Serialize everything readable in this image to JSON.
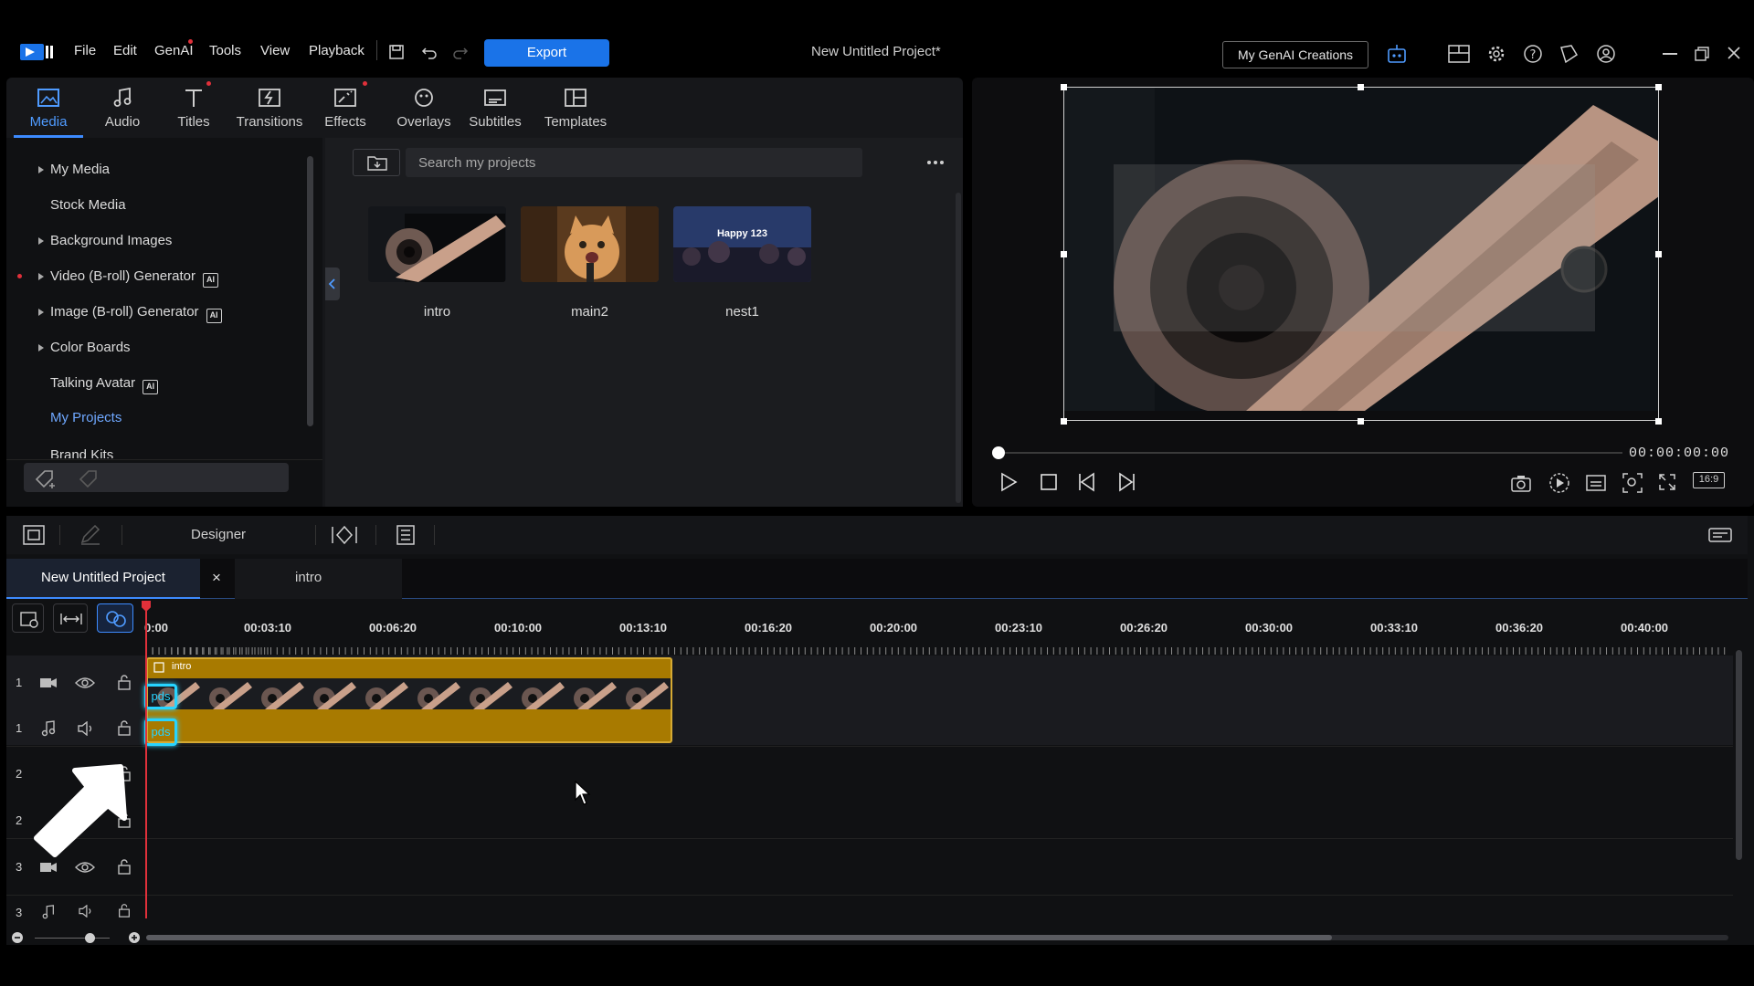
{
  "menu": {
    "items": [
      "File",
      "Edit",
      "GenAI",
      "Tools",
      "View",
      "Playback"
    ],
    "export_label": "Export",
    "project_title": "New Untitled Project*",
    "genai_button": "My GenAI Creations"
  },
  "library": {
    "tabs": [
      "Media",
      "Audio",
      "Titles",
      "Transitions",
      "Effects",
      "Overlays",
      "Subtitles",
      "Templates"
    ],
    "active_tab": "Media",
    "tree": [
      "My Media",
      "Stock Media",
      "Background Images",
      "Video (B-roll) Generator",
      "Image (B-roll) Generator",
      "Color Boards",
      "Talking Avatar",
      "My Projects",
      "Brand Kits"
    ],
    "selected_tree_item": "My Projects",
    "search_placeholder": "Search my projects",
    "media": [
      {
        "label": "intro"
      },
      {
        "label": "main2"
      },
      {
        "label": "nest1",
        "overlay_text": "Happy 123"
      }
    ]
  },
  "preview": {
    "timecode": "00:00:00:00",
    "aspect": "16:9"
  },
  "timeline": {
    "toolbar_designer": "Designer",
    "tabs": [
      "New Untitled Project",
      "intro"
    ],
    "close_glyph": "×",
    "ruler": [
      "0:00",
      "00:03:10",
      "00:06:20",
      "00:10:00",
      "00:13:10",
      "00:16:20",
      "00:20:00",
      "00:23:10",
      "00:26:20",
      "00:30:00",
      "00:33:10",
      "00:36:20",
      "00:40:00"
    ],
    "tracks": [
      "1",
      "1",
      "2",
      "2",
      "3",
      "3"
    ],
    "clip_label": "intro",
    "pds_label": "pds"
  },
  "colors": {
    "accent": "#3d8bff",
    "export": "#1a73e8",
    "clip": "#a87a00",
    "highlight": "#27d4ff",
    "playhead": "#e0303a"
  }
}
